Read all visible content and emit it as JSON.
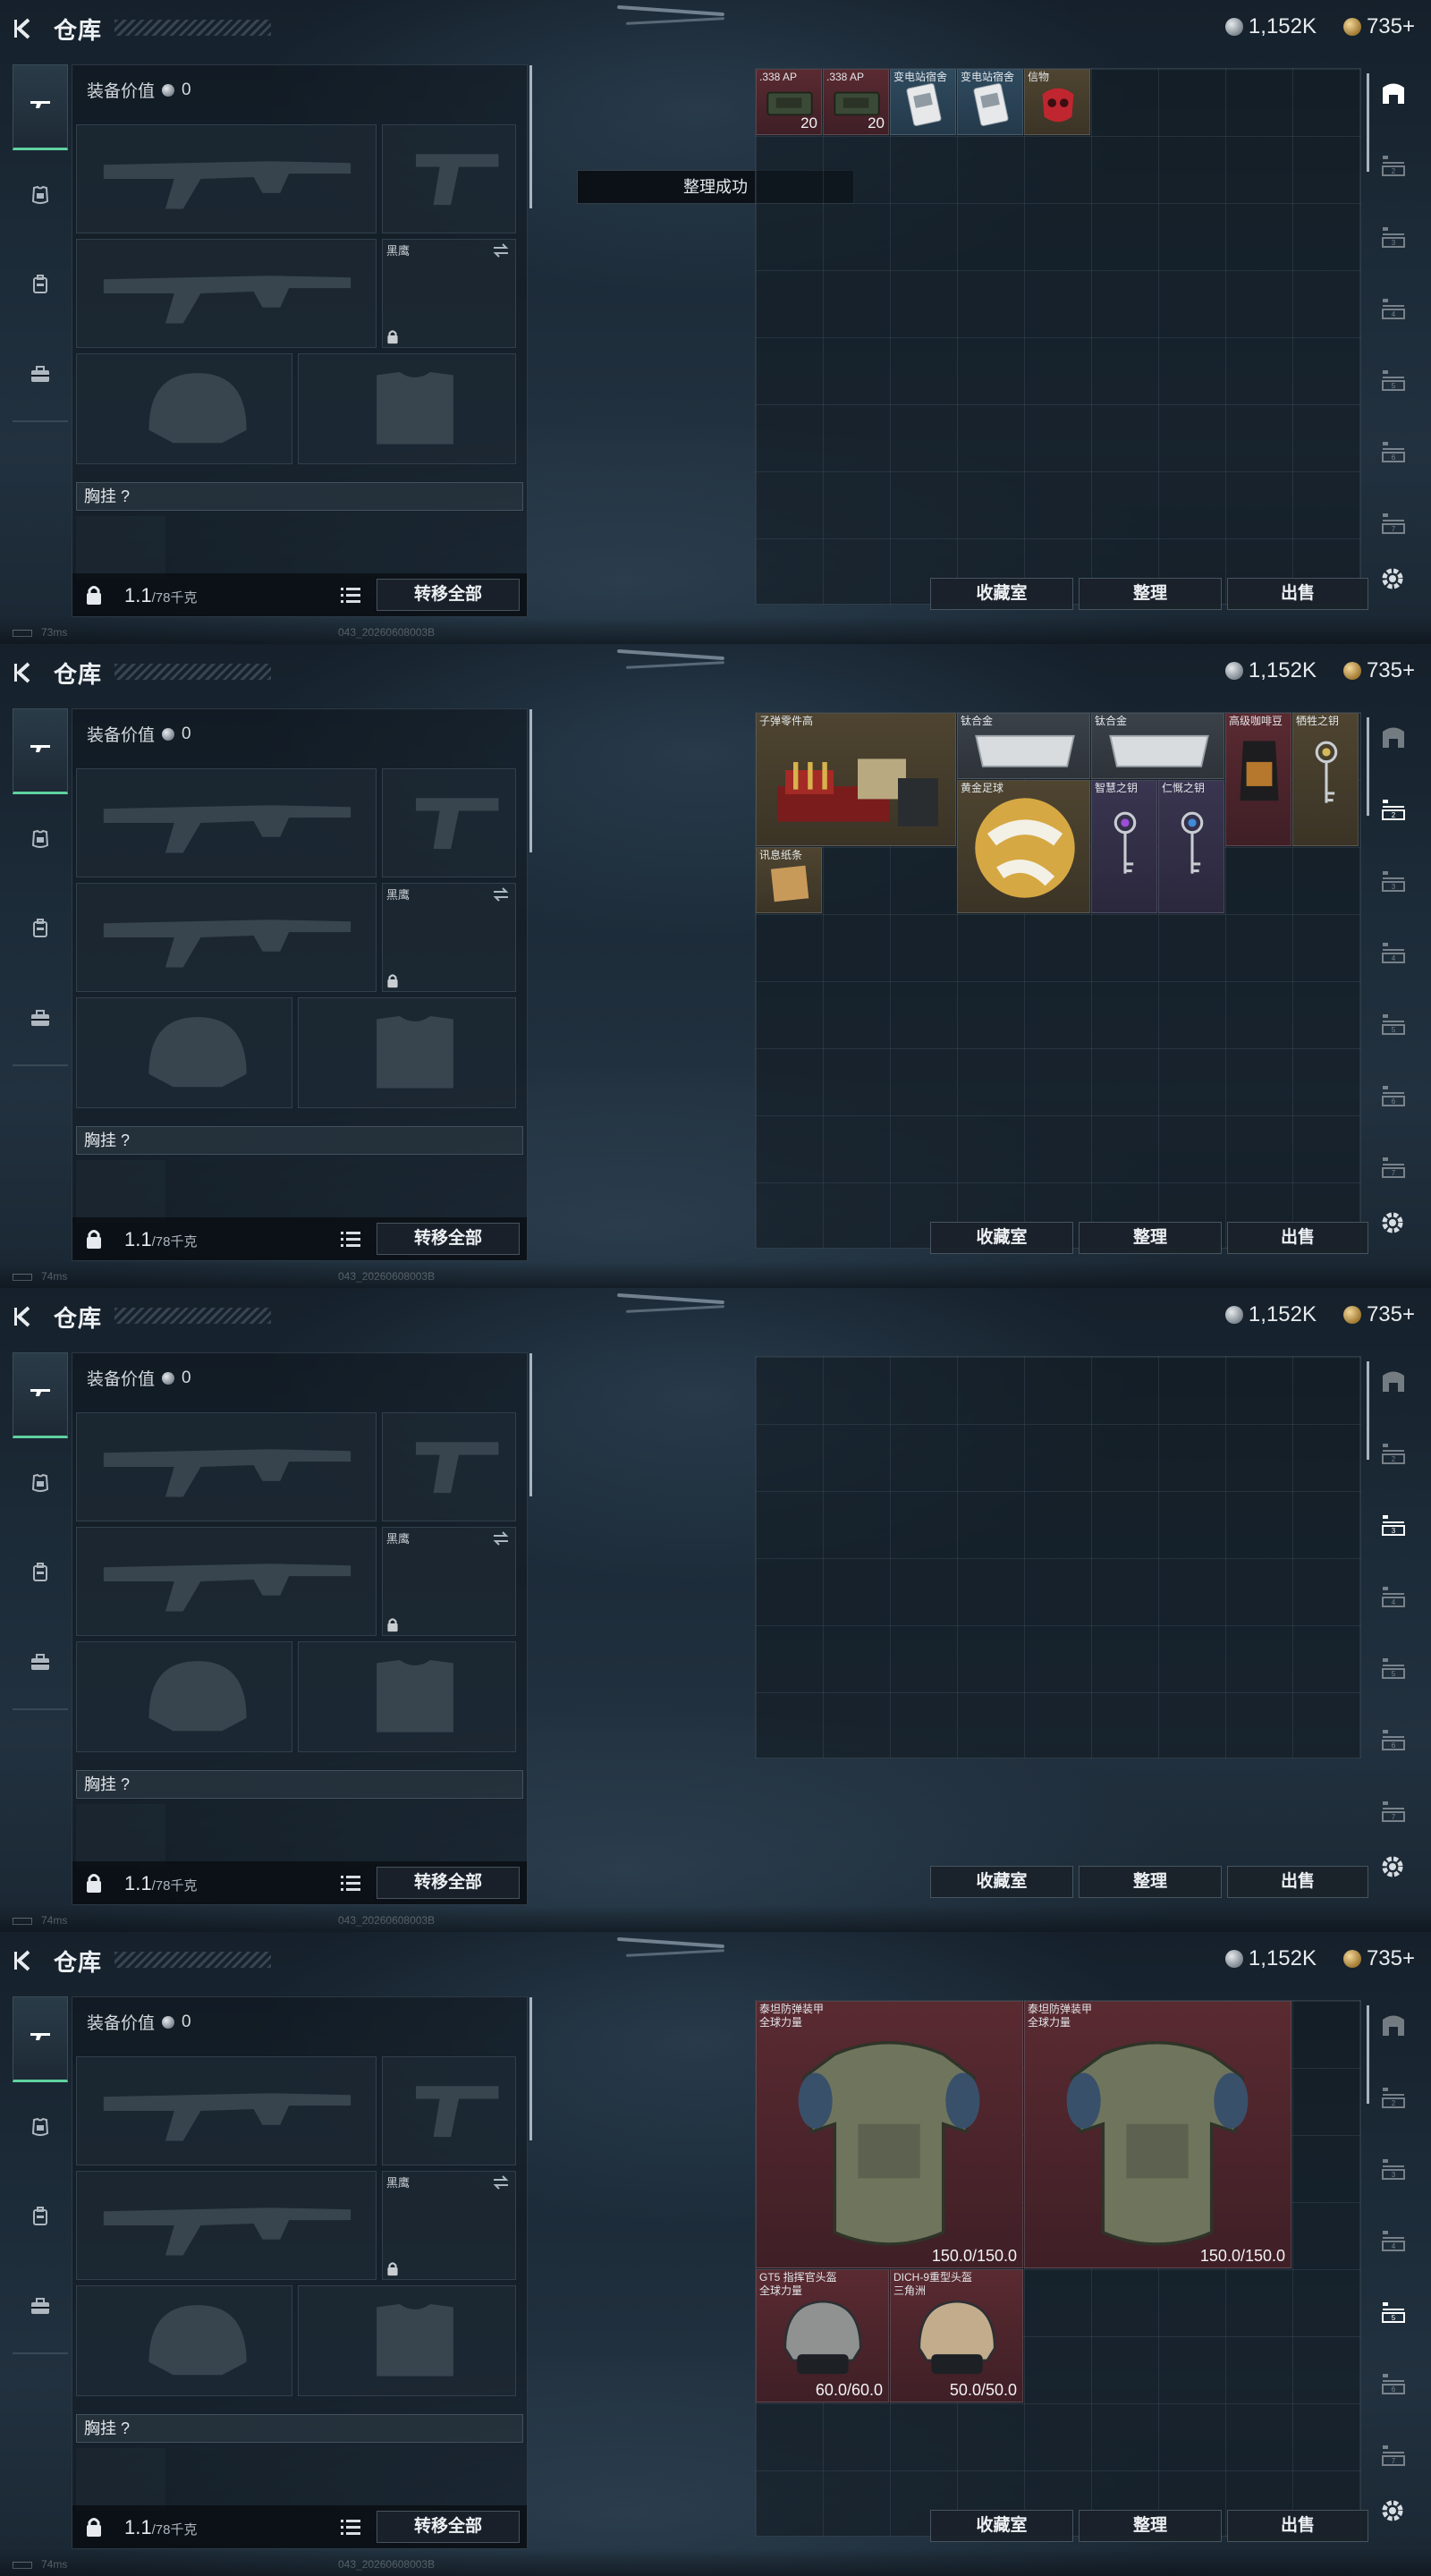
{
  "screens": [
    {
      "header": {
        "title": "仓库",
        "silver": "1,152K",
        "gold": "735+"
      },
      "loadout": {
        "value_label": "装备价值",
        "value": "0",
        "sidearm_slot_label": "黑鹰",
        "chest_label": "胸挂",
        "chest_hint": "?",
        "weight": "1.1",
        "weight_cap": "/78千克",
        "transfer_all": "转移全部"
      },
      "toast": "整理成功",
      "storage": {
        "items": [
          {
            "name": ".338 AP",
            "qty": "20"
          },
          {
            "name": ".338 AP",
            "qty": "20"
          },
          {
            "name": "变电站宿舍",
            "qty": ""
          },
          {
            "name": "变电站宿舍",
            "qty": ""
          },
          {
            "name": "信物",
            "qty": ""
          }
        ]
      },
      "footer": {
        "collection": "收藏室",
        "sort": "整理",
        "sell": "出售"
      },
      "status": {
        "ping": "73ms",
        "build": "043_20260608003B"
      }
    },
    {
      "header": {
        "title": "仓库",
        "silver": "1,152K",
        "gold": "735+"
      },
      "loadout": {
        "value_label": "装备价值",
        "value": "0",
        "sidearm_slot_label": "黑鹰",
        "chest_label": "胸挂",
        "chest_hint": "?",
        "weight": "1.1",
        "weight_cap": "/78千克",
        "transfer_all": "转移全部"
      },
      "storage": {
        "items": [
          {
            "name": "子弹零件高"
          },
          {
            "name": "钛合金"
          },
          {
            "name": "钛合金"
          },
          {
            "name": "高级咖啡豆"
          },
          {
            "name": "牺牲之钥"
          },
          {
            "name": "黄金足球"
          },
          {
            "name": "智慧之钥"
          },
          {
            "name": "仁慨之钥"
          },
          {
            "name": "讯息纸条"
          }
        ]
      },
      "footer": {
        "collection": "收藏室",
        "sort": "整理",
        "sell": "出售"
      },
      "status": {
        "ping": "74ms",
        "build": "043_20260608003B"
      }
    },
    {
      "header": {
        "title": "仓库",
        "silver": "1,152K",
        "gold": "735+"
      },
      "loadout": {
        "value_label": "装备价值",
        "value": "0",
        "sidearm_slot_label": "黑鹰",
        "chest_label": "胸挂",
        "chest_hint": "?",
        "weight": "1.1",
        "weight_cap": "/78千克",
        "transfer_all": "转移全部"
      },
      "storage": {
        "items": []
      },
      "footer": {
        "collection": "收藏室",
        "sort": "整理",
        "sell": "出售"
      },
      "status": {
        "ping": "74ms",
        "build": "043_20260608003B"
      }
    },
    {
      "header": {
        "title": "仓库",
        "silver": "1,152K",
        "gold": "735+"
      },
      "loadout": {
        "value_label": "装备价值",
        "value": "0",
        "sidearm_slot_label": "黑鹰",
        "chest_label": "胸挂",
        "chest_hint": "?",
        "weight": "1.1",
        "weight_cap": "/78千克",
        "transfer_all": "转移全部"
      },
      "storage": {
        "items": [
          {
            "name": "泰坦防弹装甲",
            "sub": "全球力量",
            "durability": "150.0/150.0"
          },
          {
            "name": "泰坦防弹装甲",
            "sub": "全球力量",
            "durability": "150.0/150.0"
          },
          {
            "name": "GT5 指挥官头盔",
            "sub": "全球力量",
            "durability": "60.0/60.0"
          },
          {
            "name": "DICH-9重型头盔",
            "sub": "三角洲",
            "durability": "50.0/50.0"
          }
        ]
      },
      "footer": {
        "collection": "收藏室",
        "sort": "整理",
        "sell": "出售"
      },
      "status": {
        "ping": "74ms",
        "build": "043_20260608003B"
      }
    }
  ],
  "colors": {
    "accent_green": "#5fd1a0",
    "rarity_red": "#5a2a31",
    "rarity_gold": "#4e4430",
    "rarity_purple": "#3a3550"
  },
  "icons": [
    "back-arrow-icon",
    "silver-coin-icon",
    "gold-coin-icon",
    "rifle-tab-icon",
    "armor-tab-icon",
    "backpack-tab-icon",
    "briefcase-tab-icon",
    "lock-icon",
    "swap-icon",
    "list-icon",
    "settings-gear-icon",
    "storage-page-icon"
  ]
}
